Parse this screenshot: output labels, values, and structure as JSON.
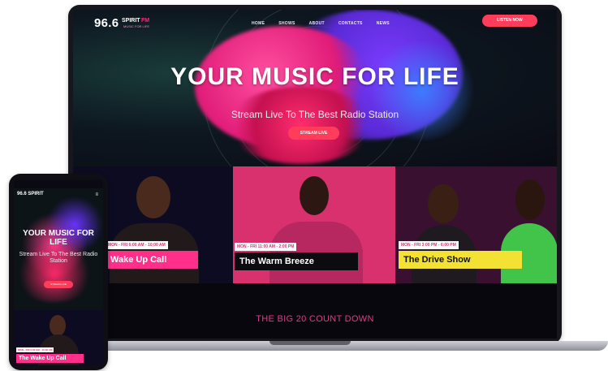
{
  "site": {
    "logo_number": "96.6",
    "logo_brand": "SPIRIT",
    "logo_fm": "FM",
    "logo_tagline": "MUSIC FOR LIFE"
  },
  "nav": {
    "items": [
      "HOME",
      "SHOWS",
      "ABOUT",
      "CONTACTS",
      "NEWS"
    ],
    "cta_label": "LISTEN NOW"
  },
  "hero": {
    "title": "YOUR MUSIC FOR LIFE",
    "subtitle": "Stream Live  To The Best Radio Station",
    "button_label": "STREAM LIVE"
  },
  "shows": [
    {
      "time": "MON - FRI 6:00 AM - 10:00 AM",
      "title": "Wake Up Call",
      "bg": "#0c0b22",
      "accent": "#ff2f8a"
    },
    {
      "time": "MON - FRI 11:00 AM - 2:00 PM",
      "title": "The Warm Breeze",
      "bg": "#d8316e",
      "accent": "#0b0b10"
    },
    {
      "time": "MON - FRI 3:00 PM - 6:00 PM",
      "title": "The Drive Show",
      "bg": "#3a1030",
      "accent": "#f3e233"
    }
  ],
  "countdown": {
    "title": "THE BIG 20 COUNT DOWN"
  },
  "phone": {
    "logo": "96.6 SPIRIT",
    "menu_icon": "hamburger-icon",
    "title": "YOUR MUSIC FOR LIFE",
    "subtitle": "Stream Live  To The Best Radio Station",
    "button_label": "STREAM LIVE",
    "show_time": "MON - FRI 6:00 AM - 10:00 AM",
    "show_title": "The Wake Up Call"
  },
  "colors": {
    "brand_pink": "#ff2f8a",
    "button_red": "#ff3d5a",
    "drive_yellow": "#f3e233"
  }
}
